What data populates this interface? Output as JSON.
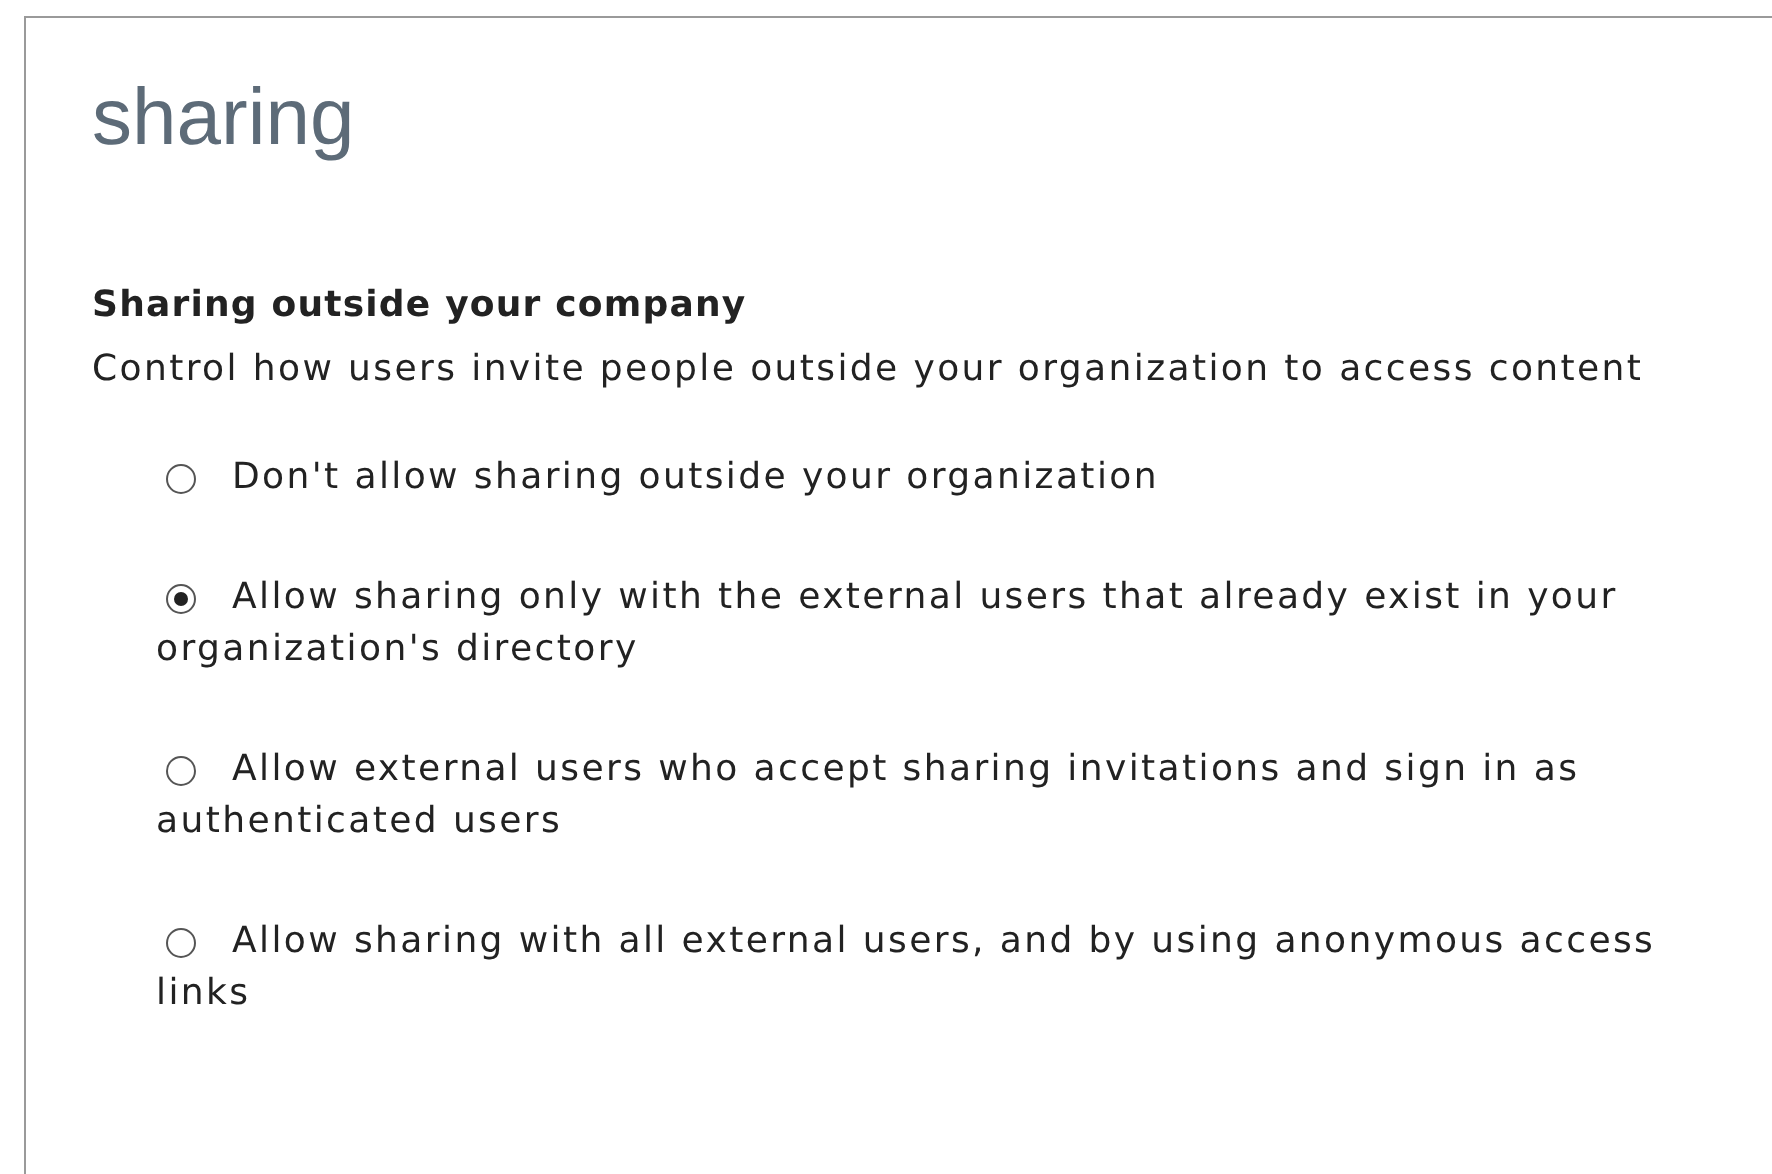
{
  "title": "sharing",
  "section": {
    "heading": "Sharing outside your company",
    "description": "Control how users invite people outside your organization to access content"
  },
  "options": [
    {
      "label": "Don't allow sharing outside your organization",
      "selected": false
    },
    {
      "label": "Allow sharing only with the external users that already exist in your organization's directory",
      "selected": true
    },
    {
      "label": "Allow external users who accept sharing invitations and sign in as authenticated users",
      "selected": false
    },
    {
      "label": "Allow sharing with all external users, and by using anonymous access links",
      "selected": false
    }
  ]
}
